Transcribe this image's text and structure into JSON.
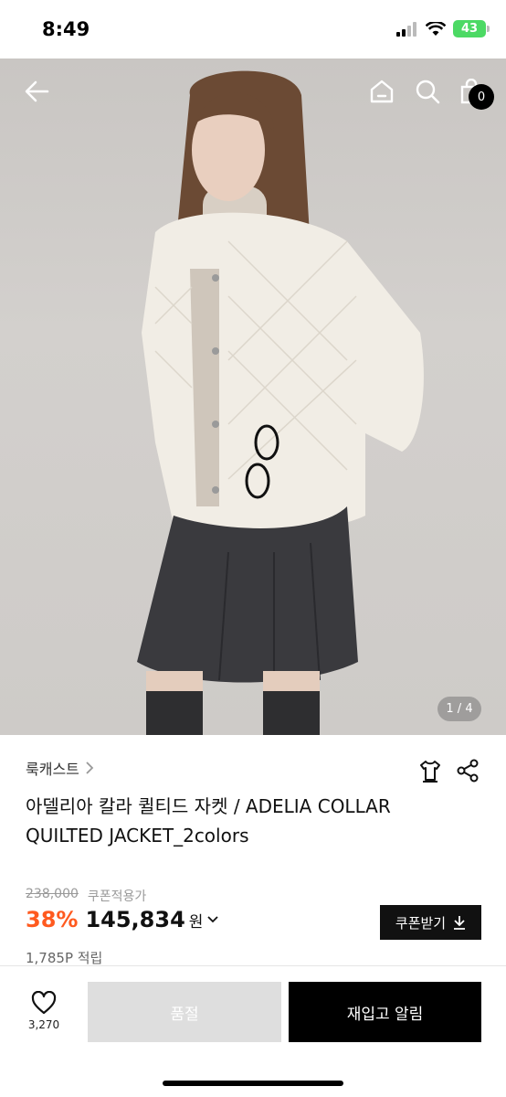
{
  "status_bar": {
    "time": "8:49",
    "battery": "43"
  },
  "header": {
    "cart_count": "0",
    "icons": [
      "back-arrow-icon",
      "home-icon",
      "search-icon",
      "cart-icon"
    ]
  },
  "gallery": {
    "indicator": "1 / 4"
  },
  "product": {
    "brand": "룩캐스트",
    "title": "아델리아 칼라 퀼티드 자켓 / ADELIA COLLAR QUILTED JACKET_2colors",
    "original_price": "238,000",
    "coupon_price_label": "쿠폰적용가",
    "discount": "38%",
    "price": "145,834",
    "currency": "원",
    "coupon_button": "쿠폰받기",
    "points": "1,785P 적립"
  },
  "bottom_bar": {
    "like_count": "3,270",
    "soldout_label": "품절",
    "restock_label": "재입고 알림"
  },
  "colors": {
    "accent_discount": "#ff5a1f",
    "primary_button": "#000000",
    "disabled_button": "#dedede"
  }
}
